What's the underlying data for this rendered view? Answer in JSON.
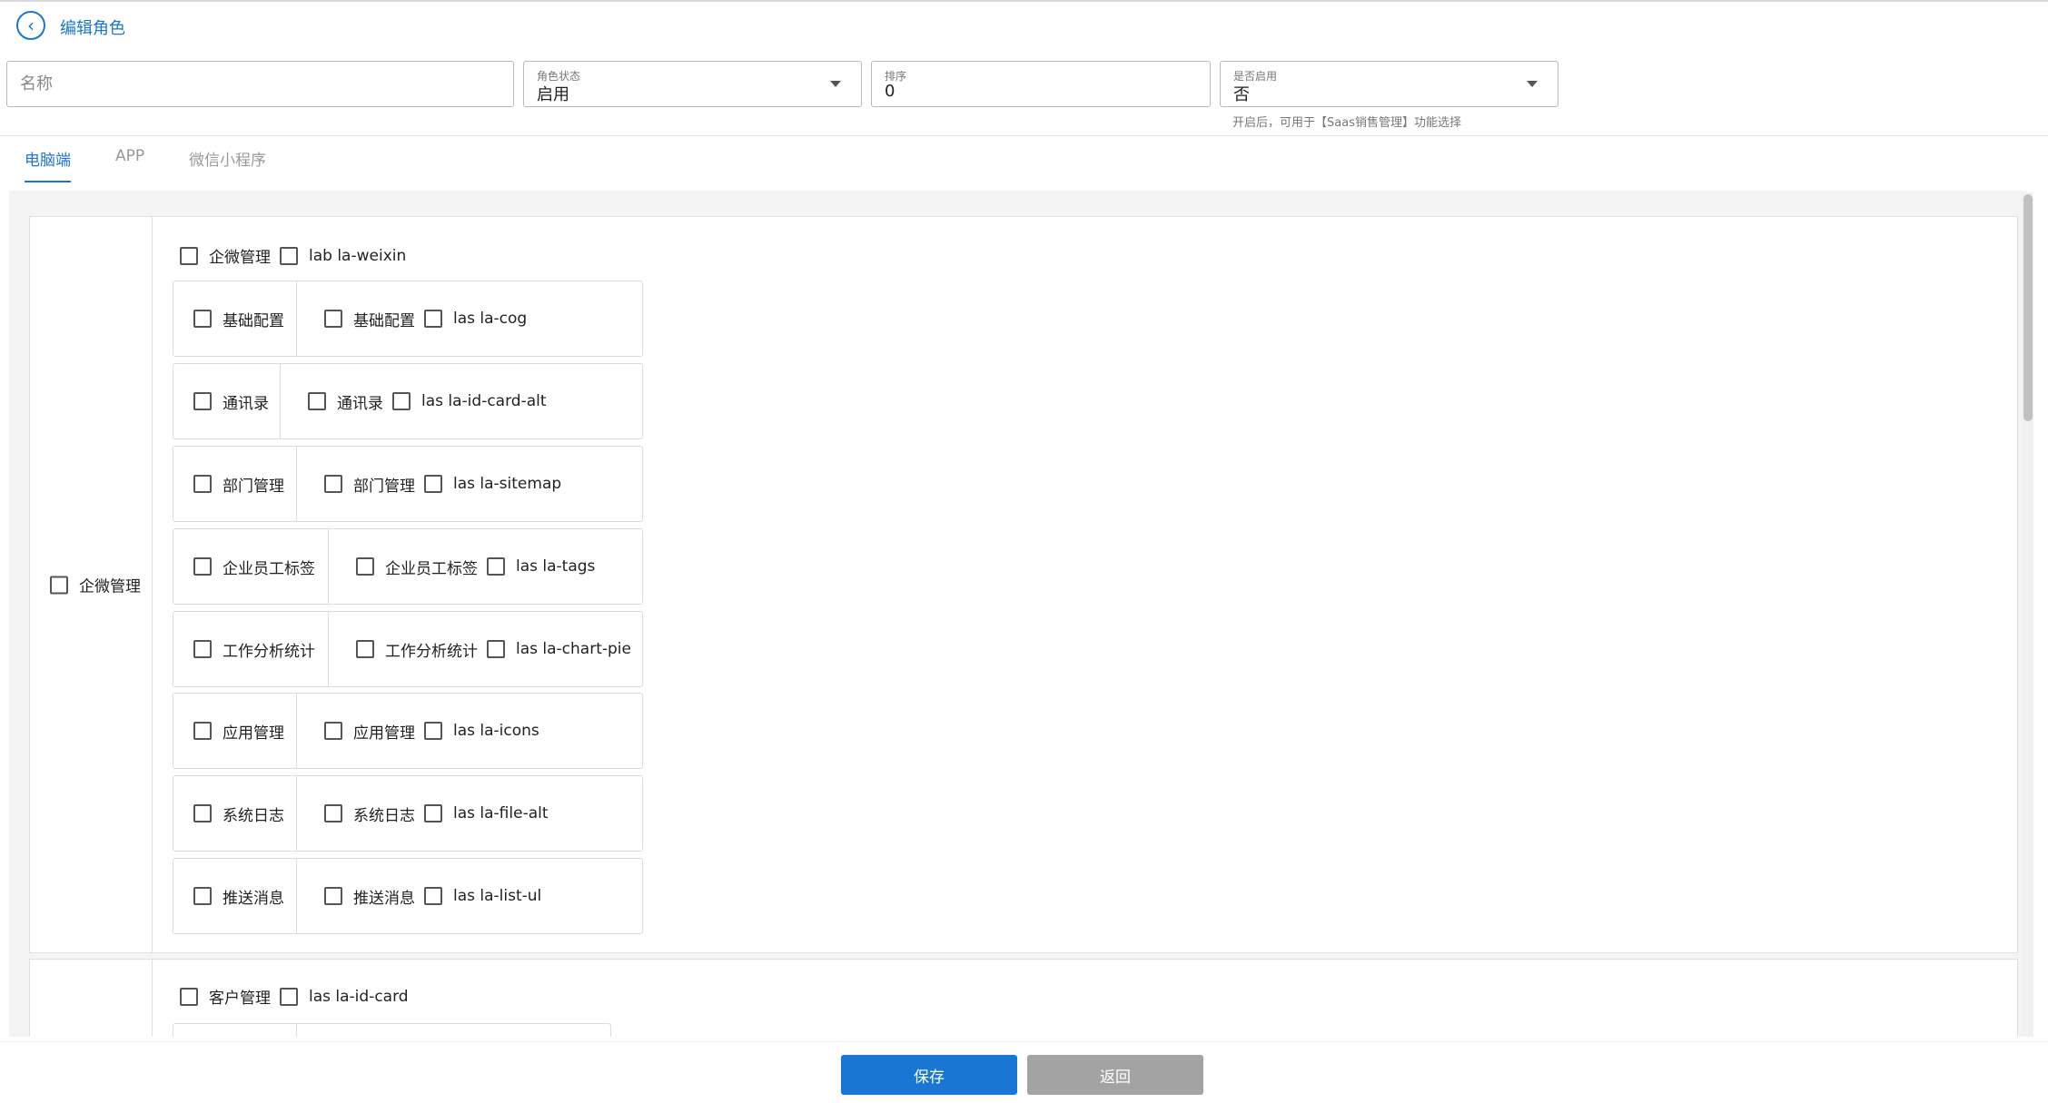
{
  "header": {
    "title": "编辑角色",
    "back_icon": "chevron-left-icon"
  },
  "form": {
    "name": {
      "placeholder": "名称",
      "value": ""
    },
    "status": {
      "label": "角色状态",
      "value": "启用"
    },
    "sort": {
      "label": "排序",
      "value": "0"
    },
    "enabled": {
      "label": "是否启用",
      "value": "否",
      "hint": "开启后，可用于【Saas销售管理】功能选择"
    }
  },
  "tabs": [
    {
      "label": "电脑端",
      "active": true
    },
    {
      "label": "APP",
      "active": false
    },
    {
      "label": "微信小程序",
      "active": false
    }
  ],
  "modules": [
    {
      "name": "企微管理",
      "head": {
        "label": "企微管理",
        "icon_label": "lab la-weixin"
      },
      "items": [
        {
          "left": "基础配置",
          "right": "基础配置",
          "icon": "las la-cog"
        },
        {
          "left": "通讯录",
          "right": "通讯录",
          "icon": "las la-id-card-alt"
        },
        {
          "left": "部门管理",
          "right": "部门管理",
          "icon": "las la-sitemap"
        },
        {
          "left": "企业员工标签",
          "right": "企业员工标签",
          "icon": "las la-tags"
        },
        {
          "left": "工作分析统计",
          "right": "工作分析统计",
          "icon": "las la-chart-pie"
        },
        {
          "left": "应用管理",
          "right": "应用管理",
          "icon": "las la-icons"
        },
        {
          "left": "系统日志",
          "right": "系统日志",
          "icon": "las la-file-alt"
        },
        {
          "left": "推送消息",
          "right": "推送消息",
          "icon": "las la-list-ul"
        }
      ]
    },
    {
      "name": "",
      "head": {
        "label": "客户管理",
        "icon_label": "las la-id-card"
      },
      "items": []
    }
  ],
  "footer": {
    "save_label": "保存",
    "back_label": "返回"
  },
  "colors": {
    "primary": "#1976d2",
    "secondary_button": "#a3a3a3"
  }
}
